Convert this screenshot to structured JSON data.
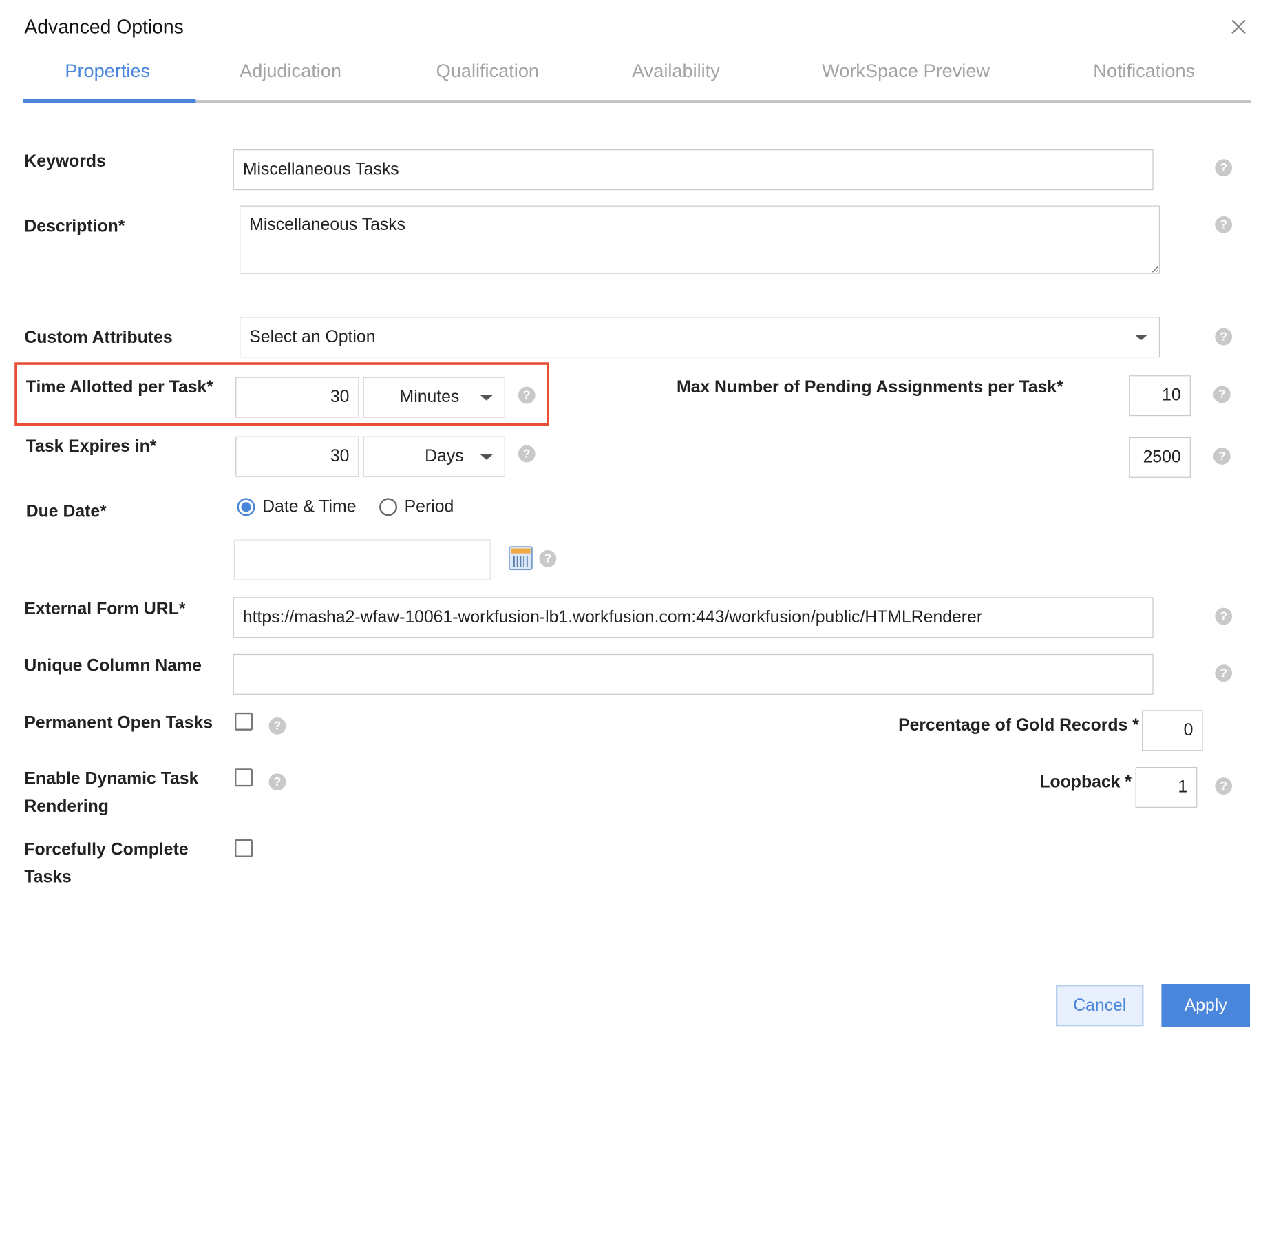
{
  "dialog": {
    "title": "Advanced Options"
  },
  "tabs": [
    {
      "label": "Properties",
      "active": true
    },
    {
      "label": "Adjudication",
      "active": false
    },
    {
      "label": "Qualification",
      "active": false
    },
    {
      "label": "Availability",
      "active": false
    },
    {
      "label": "WorkSpace Preview",
      "active": false
    },
    {
      "label": "Notifications",
      "active": false
    }
  ],
  "fields": {
    "keywords": {
      "label": "Keywords",
      "value": "Miscellaneous Tasks"
    },
    "description": {
      "label": "Description*",
      "value": "Miscellaneous Tasks"
    },
    "custom_attributes": {
      "label": "Custom Attributes",
      "value": "Select an Option"
    },
    "time_allotted": {
      "label": "Time Allotted per Task*",
      "value": "30",
      "unit": "Minutes"
    },
    "task_expires": {
      "label": "Task Expires in*",
      "value": "30",
      "unit": "Days"
    },
    "max_pending": {
      "label": "Max Number of Pending Assignments per Task*",
      "value": "10"
    },
    "second_number": {
      "value": "2500"
    },
    "due_date": {
      "label": "Due Date*",
      "option_datetime": "Date & Time",
      "option_period": "Period",
      "selected": "Date & Time",
      "value": ""
    },
    "external_form_url": {
      "label": "External Form URL*",
      "value": "https://masha2-wfaw-10061-workfusion-lb1.workfusion.com:443/workfusion/public/HTMLRenderer"
    },
    "unique_column_name": {
      "label": "Unique Column Name",
      "value": ""
    },
    "permanent_open_tasks": {
      "label": "Permanent Open Tasks",
      "checked": false
    },
    "enable_dynamic_rendering": {
      "label": "Enable Dynamic Task Rendering",
      "checked": false
    },
    "forcefully_complete": {
      "label": "Forcefully Complete Tasks",
      "checked": false
    },
    "gold_records": {
      "label": "Percentage of Gold Records *",
      "value": "0"
    },
    "loopback": {
      "label": "Loopback *",
      "value": "1"
    }
  },
  "help_glyph": "?",
  "buttons": {
    "cancel": "Cancel",
    "apply": "Apply"
  },
  "colors": {
    "accent": "#4a86dc",
    "highlight": "#e84e35",
    "help": "#c9c9c9"
  },
  "icons": {
    "close": "close-icon",
    "help": "help-icon",
    "calendar": "calendar-icon",
    "dropdown": "chevron-down-icon"
  }
}
